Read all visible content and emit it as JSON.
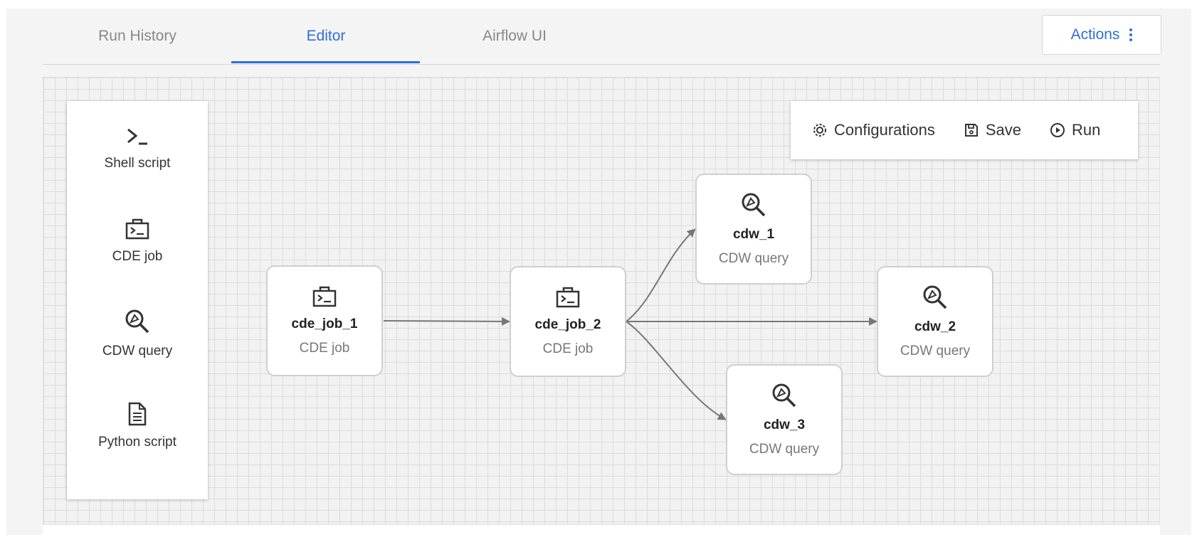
{
  "tabs": [
    {
      "label": "Run History",
      "active": false
    },
    {
      "label": "Editor",
      "active": true
    },
    {
      "label": "Airflow UI",
      "active": false
    }
  ],
  "actions": {
    "label": "Actions",
    "icon": "kebab-vertical-icon"
  },
  "palette": {
    "items": [
      {
        "label": "Shell script",
        "icon": "terminal-prompt-icon"
      },
      {
        "label": "CDE job",
        "icon": "briefcase-terminal-icon"
      },
      {
        "label": "CDW query",
        "icon": "magnifier-icon"
      },
      {
        "label": "Python script",
        "icon": "document-icon"
      }
    ]
  },
  "toolbar": {
    "configurations": {
      "label": "Configurations",
      "icon": "gear-icon"
    },
    "save": {
      "label": "Save",
      "icon": "floppy-disk-icon"
    },
    "run": {
      "label": "Run",
      "icon": "play-circle-icon"
    }
  },
  "nodes": [
    {
      "id": "cde_job_1",
      "name": "cde_job_1",
      "type": "CDE job"
    },
    {
      "id": "cde_job_2",
      "name": "cde_job_2",
      "type": "CDE job"
    },
    {
      "id": "cdw_1",
      "name": "cdw_1",
      "type": "CDW query"
    },
    {
      "id": "cdw_2",
      "name": "cdw_2",
      "type": "CDW query"
    },
    {
      "id": "cdw_3",
      "name": "cdw_3",
      "type": "CDW query"
    }
  ],
  "edges": [
    {
      "from": "cde_job_1",
      "to": "cde_job_2"
    },
    {
      "from": "cde_job_2",
      "to": "cdw_1"
    },
    {
      "from": "cde_job_2",
      "to": "cdw_2"
    },
    {
      "from": "cde_job_2",
      "to": "cdw_3"
    }
  ],
  "colors": {
    "accent": "#2f6fd6",
    "edge": "#777777",
    "node_border": "#cfcfcf"
  }
}
